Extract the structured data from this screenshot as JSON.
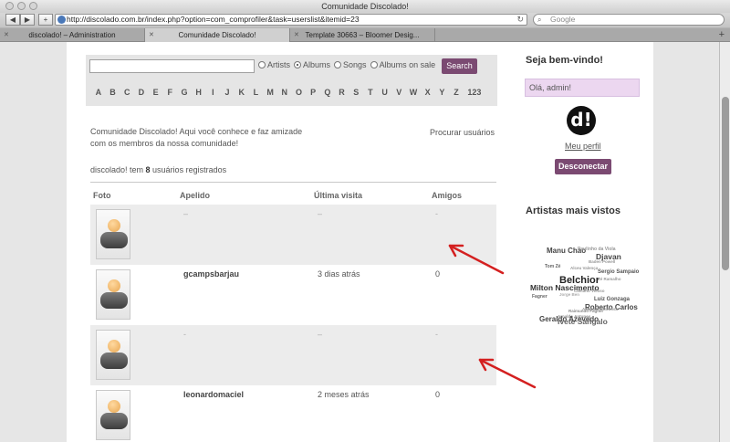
{
  "window": {
    "title": "Comunidade Discolado!"
  },
  "toolbar": {
    "back": "◀",
    "forward": "▶",
    "add": "+",
    "url": "http://discolado.com.br/index.php?option=com_comprofiler&task=userslist&itemid=23",
    "search_placeholder": "Google"
  },
  "tabs": [
    {
      "label": "discolado! – Administration",
      "active": false
    },
    {
      "label": "Comunidade Discolado!",
      "active": true
    },
    {
      "label": "Template 30663 – Bloomer Desig...",
      "active": false
    }
  ],
  "search": {
    "options": [
      "Artists",
      "Albums",
      "Songs",
      "Albums on sale"
    ],
    "selected": "Albums",
    "button": "Search"
  },
  "letters": [
    "A",
    "B",
    "C",
    "D",
    "E",
    "F",
    "G",
    "H",
    "I",
    "J",
    "K",
    "L",
    "M",
    "N",
    "O",
    "P",
    "Q",
    "R",
    "S",
    "T",
    "U",
    "V",
    "W",
    "X",
    "Y",
    "Z",
    "123"
  ],
  "intro": {
    "text": "Comunidade Discolado! Aqui você conhece e faz amizade com os membros da nossa comunidade!",
    "procurar": "Procurar usuários",
    "count_prefix": "discolado! tem ",
    "count": "8",
    "count_suffix": " usuários registrados"
  },
  "table": {
    "headers": [
      "Foto",
      "Apelido",
      "Última visita",
      "Amigos"
    ],
    "rows": [
      {
        "nick": "–",
        "last_visit": "–",
        "friends": "-"
      },
      {
        "nick": "gcampsbarjau",
        "last_visit": "3 dias atrás",
        "friends": "0"
      },
      {
        "nick": "-",
        "last_visit": "–",
        "friends": "-"
      },
      {
        "nick": "leonardomaciel",
        "last_visit": "2 meses atrás",
        "friends": "0"
      }
    ]
  },
  "sidebar": {
    "welcome": "Seja bem-vindo!",
    "hello": "Olá, admin!",
    "logo": "d!",
    "profile_link": "Meu perfil",
    "logout": "Desconectar",
    "artists_title": "Artistas mais vistos"
  },
  "tag_cloud": [
    {
      "name": "Manu Chao"
    },
    {
      "name": "Paulinho da Viola"
    },
    {
      "name": "Djavan"
    },
    {
      "name": "Baden Powell"
    },
    {
      "name": "Tom Zé"
    },
    {
      "name": "Alceu Valença"
    },
    {
      "name": "Sergio Sampaio"
    },
    {
      "name": "Belchior"
    },
    {
      "name": "Zé Ramalho"
    },
    {
      "name": "Milton Nascimento"
    },
    {
      "name": "Caetano Veloso"
    },
    {
      "name": "Fagner"
    },
    {
      "name": "Luiz Gonzaga"
    },
    {
      "name": "Roberto Carlos"
    },
    {
      "name": "Adoniran Barbosa"
    },
    {
      "name": "Raimundo Fagner"
    },
    {
      "name": "Arnaldo Antunes"
    },
    {
      "name": "Geraldo Azevedo"
    },
    {
      "name": "Ivete Sangalo"
    },
    {
      "name": "Jorge Ben"
    }
  ]
}
